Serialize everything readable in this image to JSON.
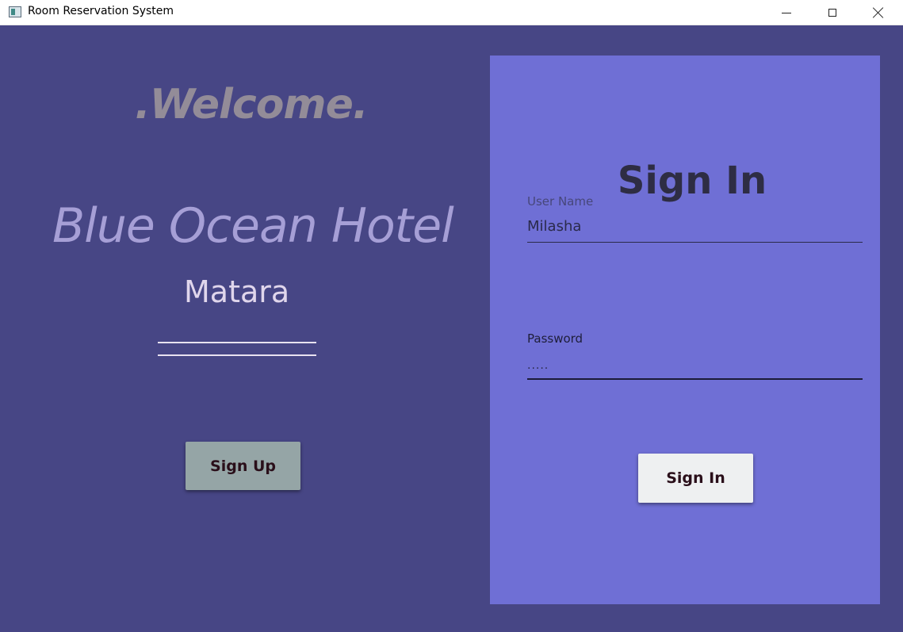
{
  "window": {
    "title": "Room Reservation System",
    "controls": [
      "minimize",
      "maximize",
      "close"
    ]
  },
  "left_panel": {
    "welcome": ".Welcome.",
    "hotel_name": "Blue Ocean Hotel",
    "city": "Matara",
    "signup_label": "Sign Up"
  },
  "signin": {
    "heading": "Sign In",
    "username_label": "User Name",
    "username_value": "Milasha",
    "password_label": "Password",
    "password_value": ".....",
    "button_label": "Sign In"
  },
  "colors": {
    "background": "#474685",
    "card": "#6f6fd5",
    "signup_button": "#95a5a6",
    "signin_button": "#eef0f1",
    "welcome_text": "#938c98",
    "hotel_text": "#a69fd6"
  },
  "icons": {
    "app": "app-window-icon",
    "minimize": "minimize-icon",
    "maximize": "maximize-icon",
    "close": "close-icon"
  }
}
